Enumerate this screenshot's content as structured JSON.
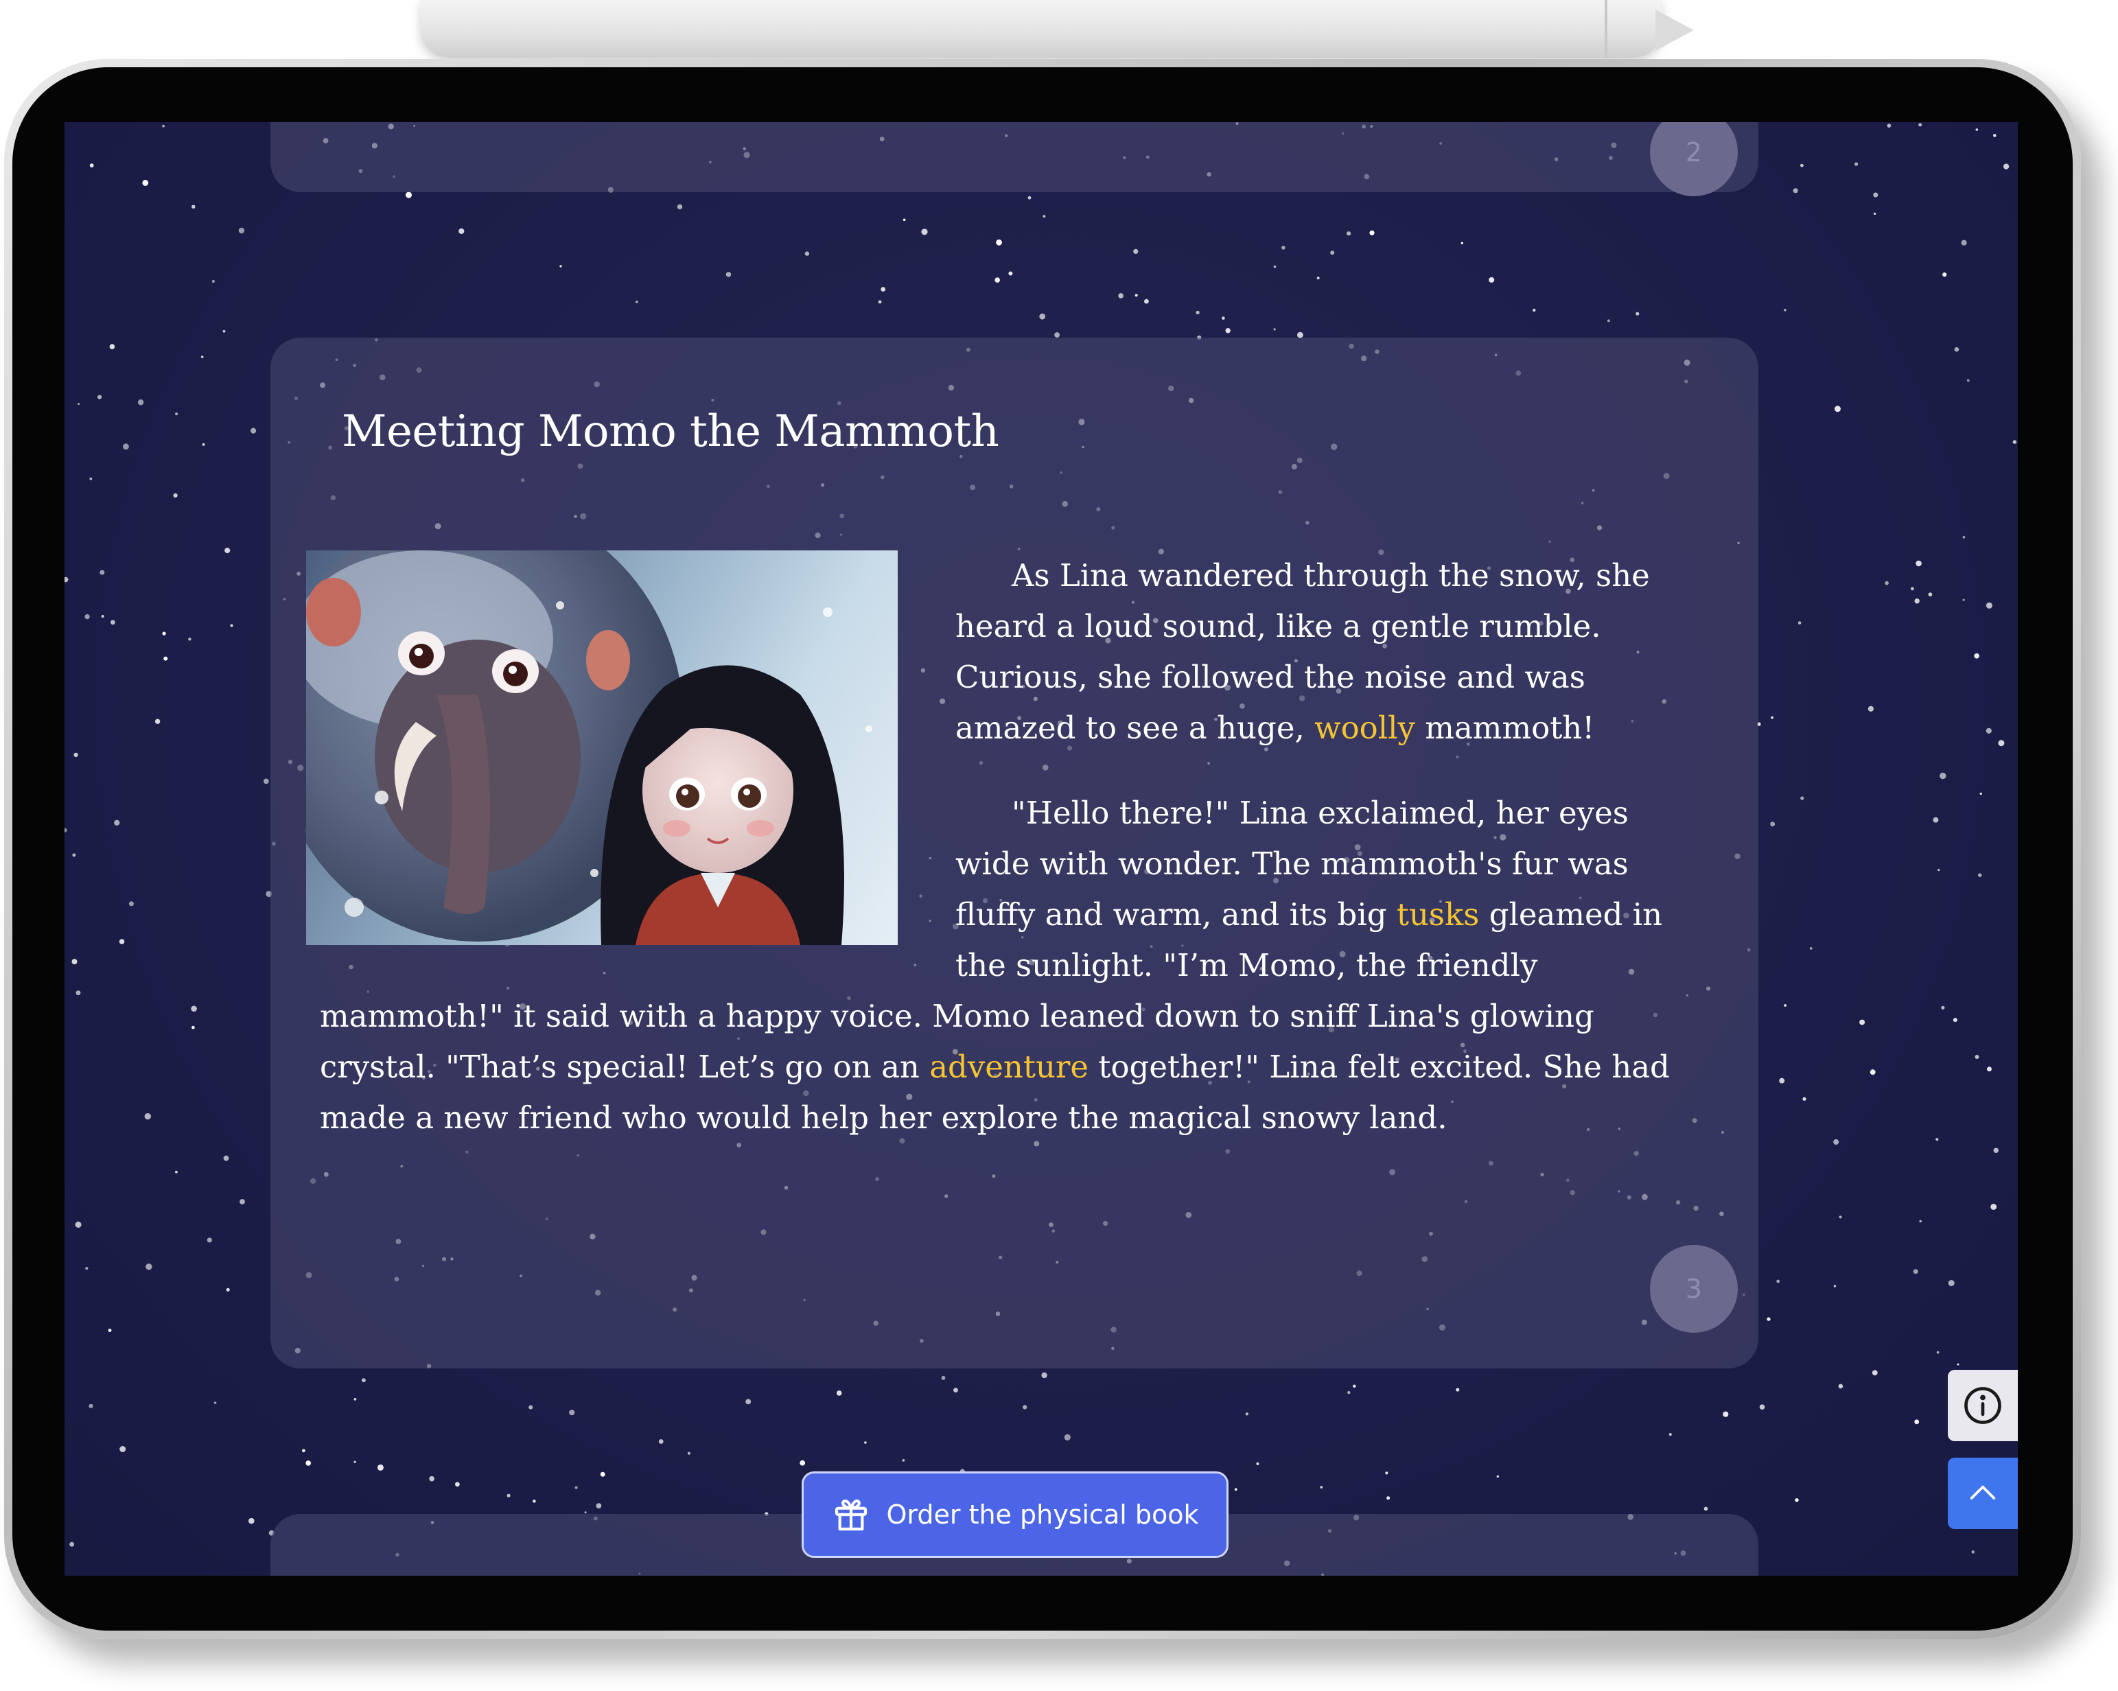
{
  "story": {
    "previous_page_number": "2",
    "page_number": "3",
    "title": "Meeting Momo the Mammoth",
    "paragraph1": {
      "before": "As Lina wandered through the snow, she heard a loud sound, like a gentle rumble. Curious, she followed the noise and was amazed to see a huge, ",
      "highlight": "woolly",
      "after": " mammoth!"
    },
    "paragraph2": {
      "part1": "\"Hello there!\" Lina exclaimed, her eyes wide with wonder. The mammoth's fur was fluffy and warm, and its big ",
      "highlight1": "tusks",
      "part2": " gleamed in the sunlight. \"I’m Momo, the friendly mammoth!\" it said with a happy voice. Momo leaned down to sniff Lina's glowing crystal. \"That’s special! Let’s go on an ",
      "highlight2": "adventure",
      "part3": " together!\" Lina felt excited. She had made a new friend who would help her explore the magical snowy land."
    },
    "highlight_color": "#f6c531"
  },
  "controls": {
    "order_label": "Order the physical book",
    "order_icon": "gift-icon",
    "info_icon": "info-icon",
    "scroll_top_icon": "chevron-up-icon",
    "accent_color": "#4b65e6"
  }
}
